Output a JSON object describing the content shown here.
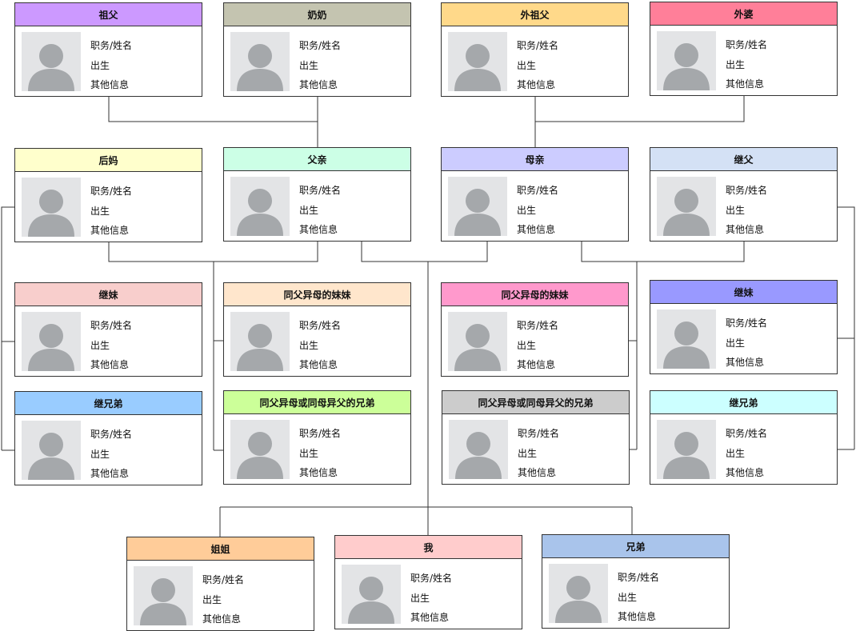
{
  "field_labels": {
    "name": "职务/姓名",
    "birth": "出生",
    "other": "其他信息"
  },
  "people": [
    {
      "id": "grandfather",
      "title": "祖父",
      "color": "#cc99ff"
    },
    {
      "id": "grandmother",
      "title": "奶奶",
      "color": "#c4c4b0"
    },
    {
      "id": "maternal-grandfather",
      "title": "外祖父",
      "color": "#ffd98a"
    },
    {
      "id": "maternal-grandmother",
      "title": "外婆",
      "color": "#ff7f99"
    },
    {
      "id": "stepmother",
      "title": "后妈",
      "color": "#ffffcc"
    },
    {
      "id": "father",
      "title": "父亲",
      "color": "#ccffe6"
    },
    {
      "id": "mother",
      "title": "母亲",
      "color": "#ccccff"
    },
    {
      "id": "stepfather",
      "title": "继父",
      "color": "#d4e1f5"
    },
    {
      "id": "stepsister-left",
      "title": "继妹",
      "color": "#f8cecc"
    },
    {
      "id": "half-sister-paternal",
      "title": "同父异母的妹妹",
      "color": "#ffe6cc"
    },
    {
      "id": "half-sister-maternal",
      "title": "同父异母的妹妹",
      "color": "#ff99cc"
    },
    {
      "id": "stepsister-right",
      "title": "继妹",
      "color": "#9999ff"
    },
    {
      "id": "stepbrother-left",
      "title": "继兄弟",
      "color": "#99ccff"
    },
    {
      "id": "half-brother-paternal",
      "title": "同父异母或同母异父的兄弟",
      "color": "#ccff99"
    },
    {
      "id": "half-brother-maternal",
      "title": "同父异母或同母异父的兄弟",
      "color": "#cccccc"
    },
    {
      "id": "stepbrother-right",
      "title": "继兄弟",
      "color": "#ccffff"
    },
    {
      "id": "older-sister",
      "title": "姐姐",
      "color": "#ffcc99"
    },
    {
      "id": "me",
      "title": "我",
      "color": "#ffcccc"
    },
    {
      "id": "brother",
      "title": "兄弟",
      "color": "#a9c4eb"
    }
  ]
}
